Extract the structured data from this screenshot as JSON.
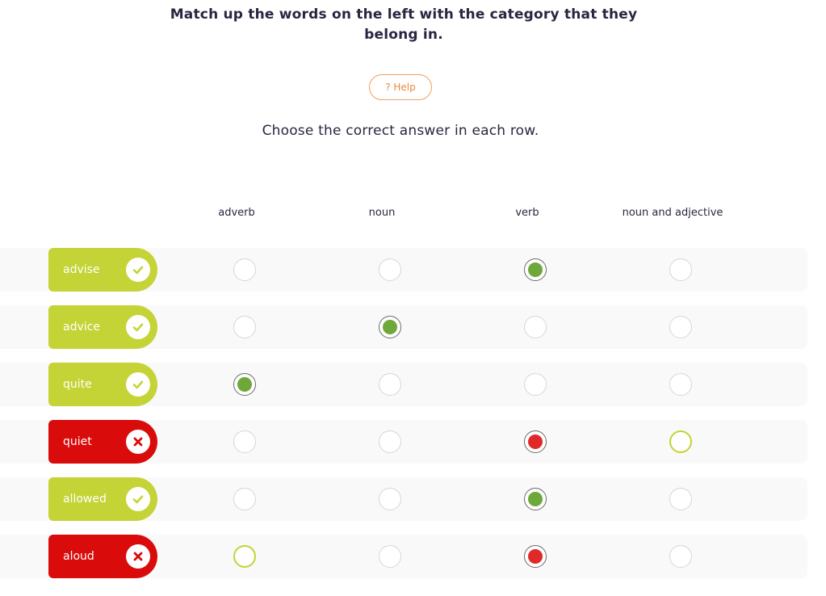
{
  "instruction": "Match up the words on the left with the category that they belong in.",
  "help_label": "? Help",
  "prompt": "Choose the correct answer in each row.",
  "columns": [
    "adverb",
    "noun",
    "verb",
    "noun and adjective"
  ],
  "colors": {
    "correct_pill": "#c4d335",
    "wrong_pill": "#da0b0b",
    "selected_correct": "#6ea83a",
    "selected_wrong": "#e02a2a",
    "correct_answer_ring": "#c4d335",
    "help_accent": "#f0a05a"
  },
  "rows": [
    {
      "word": "advise",
      "result": "correct",
      "status_icon": "check-icon",
      "selected": 2,
      "correct_answer": 2
    },
    {
      "word": "advice",
      "result": "correct",
      "status_icon": "check-icon",
      "selected": 1,
      "correct_answer": 1
    },
    {
      "word": "quite",
      "result": "correct",
      "status_icon": "check-icon",
      "selected": 0,
      "correct_answer": 0
    },
    {
      "word": "quiet",
      "result": "wrong",
      "status_icon": "cross-icon",
      "selected": 2,
      "correct_answer": 3
    },
    {
      "word": "allowed",
      "result": "correct",
      "status_icon": "check-icon",
      "selected": 2,
      "correct_answer": 2
    },
    {
      "word": "aloud",
      "result": "wrong",
      "status_icon": "cross-icon",
      "selected": 2,
      "correct_answer": 0
    }
  ]
}
